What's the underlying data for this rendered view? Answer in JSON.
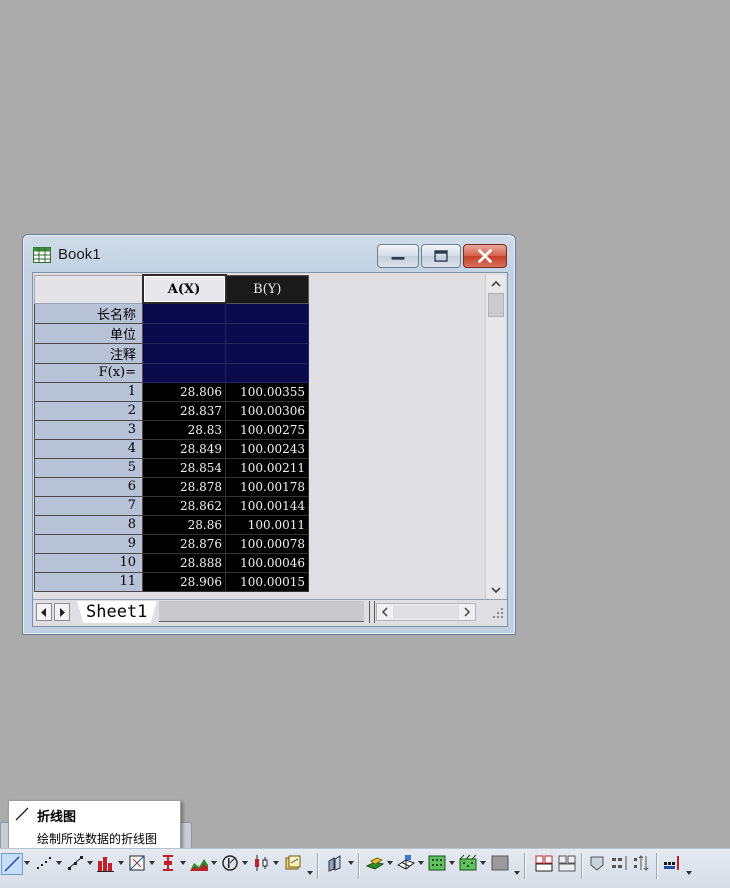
{
  "window": {
    "title": "Book1",
    "minimize_label": "minimize",
    "maximize_label": "maximize",
    "close_label": "close"
  },
  "sheet": {
    "columns": [
      {
        "header": "A(X)"
      },
      {
        "header": "B(Y)"
      }
    ],
    "meta_rows": [
      "长名称",
      "单位",
      "注释",
      "F(x)="
    ],
    "rows": [
      {
        "n": "1",
        "a": "28.806",
        "b": "100.00355"
      },
      {
        "n": "2",
        "a": "28.837",
        "b": "100.00306"
      },
      {
        "n": "3",
        "a": "28.83",
        "b": "100.00275"
      },
      {
        "n": "4",
        "a": "28.849",
        "b": "100.00243"
      },
      {
        "n": "5",
        "a": "28.854",
        "b": "100.00211"
      },
      {
        "n": "6",
        "a": "28.878",
        "b": "100.00178"
      },
      {
        "n": "7",
        "a": "28.862",
        "b": "100.00144"
      },
      {
        "n": "8",
        "a": "28.86",
        "b": "100.0011"
      },
      {
        "n": "9",
        "a": "28.876",
        "b": "100.00078"
      },
      {
        "n": "10",
        "a": "28.888",
        "b": "100.00046"
      },
      {
        "n": "11",
        "a": "28.906",
        "b": "100.00015"
      }
    ],
    "tab_label": "Sheet1"
  },
  "tooltip": {
    "title": "折线图",
    "description": "绘制所选数据的折线图"
  },
  "toolbar": {
    "icons": [
      "line-plot-icon",
      "scatter-plot-icon",
      "line-symbol-plot-icon",
      "column-plot-icon",
      "box-chart-icon",
      "error-bar-icon",
      "area-plot-icon",
      "polar-plot-icon",
      "high-low-close-icon",
      "template-library-icon",
      "3d-bars-icon",
      "3d-surface-icon",
      "3d-wire-icon",
      "contour-icon",
      "heatmap-icon",
      "image-plot-icon",
      "merge-graph-icon",
      "layer-graph-icon",
      "mask-icon",
      "stack-icon",
      "panel-icon",
      "bar-set-icon"
    ]
  },
  "colors": {
    "background": "#ababab",
    "meta_cell": "#0a0a4c",
    "data_cell": "#000000",
    "row_header": "#b7c2d6",
    "close_button": "#c3402a"
  }
}
